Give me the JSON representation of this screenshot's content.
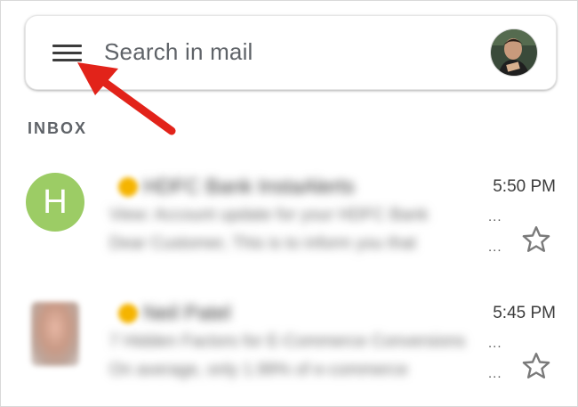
{
  "search": {
    "placeholder": "Search in mail"
  },
  "section": {
    "label": "INBOX"
  },
  "emails": [
    {
      "avatar_letter": "H",
      "sender": "HDFC Bank InstaAlerts",
      "line1": "View: Account update for your HDFC Bank",
      "line2": "Dear Customer, This is to inform you that",
      "time": "5:50 PM",
      "ellipsis1": "...",
      "ellipsis2": "..."
    },
    {
      "sender": "Neil Patel",
      "line1": "7 Hidden Factors for E-Commerce Conversions",
      "line2": "On average, only 1.99% of e-commerce",
      "time": "5:45 PM",
      "ellipsis1": "...",
      "ellipsis2": "..."
    }
  ],
  "colors": {
    "avatar_green": "#9ccc65",
    "important_yellow": "#f5b400",
    "annotation_arrow": "#e2231a"
  },
  "icons": [
    "menu-icon",
    "profile-avatar",
    "star-icon",
    "important-marker-icon",
    "arrow-annotation"
  ]
}
